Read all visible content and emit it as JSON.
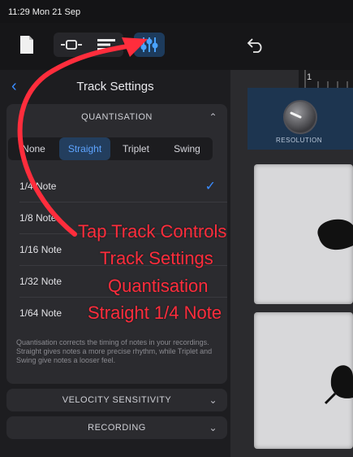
{
  "status_bar": {
    "time_date": "11:29  Mon 21 Sep"
  },
  "toolbar": {
    "icons": [
      "document-icon",
      "tracks-view-icon",
      "list-view-icon",
      "track-controls-icon",
      "undo-icon"
    ]
  },
  "panel": {
    "title": "Track Settings",
    "quantisation": {
      "header": "QUANTISATION",
      "modes": [
        "None",
        "Straight",
        "Triplet",
        "Swing"
      ],
      "selected_mode": "Straight",
      "notes": [
        "1/4 Note",
        "1/8 Note",
        "1/16 Note",
        "1/32 Note",
        "1/64 Note"
      ],
      "selected_note": "1/4 Note",
      "description": "Quantisation corrects the timing of notes in your recordings. Straight gives notes a more precise rhythm, while Triplet and Swing give notes a looser feel."
    },
    "velocity_header": "VELOCITY SENSITIVITY",
    "recording_header": "RECORDING"
  },
  "drum_area": {
    "knob_label": "RESOLUTION",
    "ruler_marker": "1"
  },
  "annotation": {
    "lines": [
      "Tap Track Controls",
      "Track Settings",
      "Quantisation",
      "Straight 1/4 Note"
    ],
    "color": "#ff2d3c"
  },
  "colors": {
    "accent": "#3a8cff",
    "selected_segment_bg": "#233e5e"
  }
}
